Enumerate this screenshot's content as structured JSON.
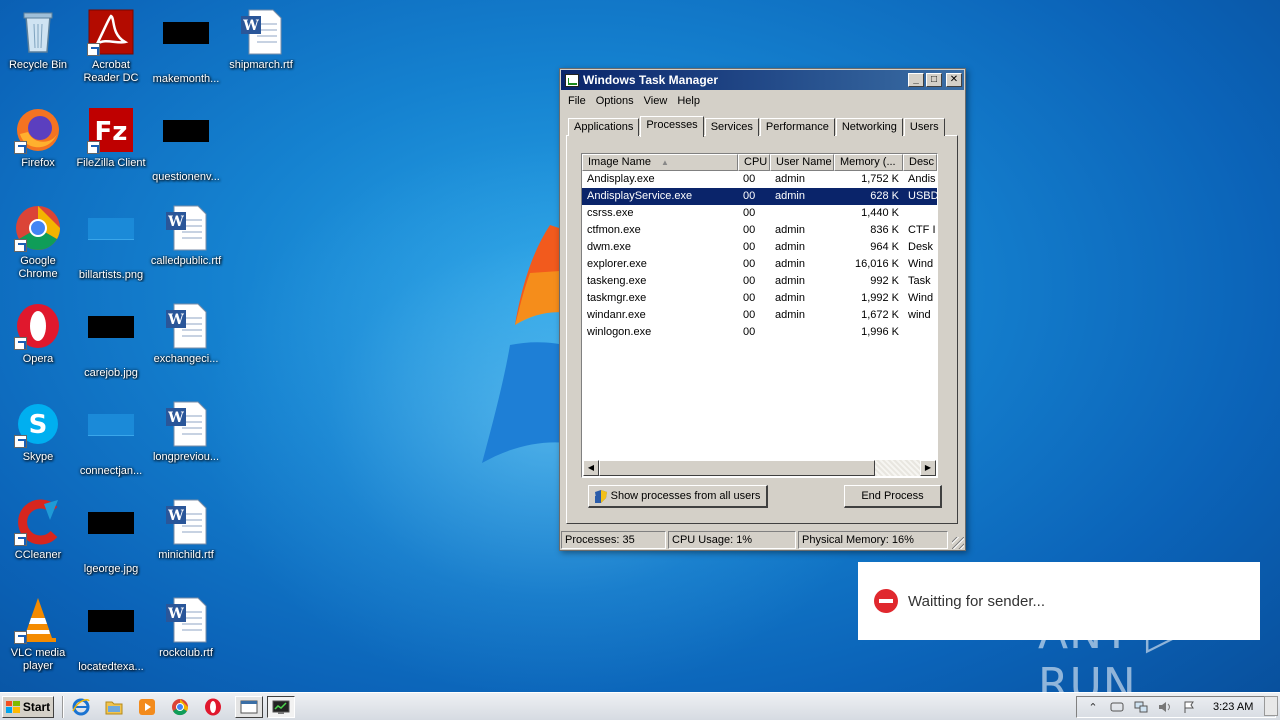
{
  "desktop": {
    "icons": [
      {
        "label": "Recycle Bin"
      },
      {
        "label": "Acrobat Reader DC"
      },
      {
        "label": "makemonth..."
      },
      {
        "label": "shipmarch.rtf"
      },
      {
        "label": "Firefox"
      },
      {
        "label": "FileZilla Client"
      },
      {
        "label": "questionenv..."
      },
      {
        "label": "Google Chrome"
      },
      {
        "label": "billartists.png"
      },
      {
        "label": "calledpublic.rtf"
      },
      {
        "label": "Opera"
      },
      {
        "label": "carejob.jpg"
      },
      {
        "label": "exchangeci..."
      },
      {
        "label": "Skype"
      },
      {
        "label": "connectjan..."
      },
      {
        "label": "longpreviou..."
      },
      {
        "label": "CCleaner"
      },
      {
        "label": "lgeorge.jpg"
      },
      {
        "label": "minichild.rtf"
      },
      {
        "label": "VLC media player"
      },
      {
        "label": "locatedtexa..."
      },
      {
        "label": "rockclub.rtf"
      }
    ]
  },
  "taskmanager": {
    "title": "Windows Task Manager",
    "menu": [
      "File",
      "Options",
      "View",
      "Help"
    ],
    "tabs": [
      "Applications",
      "Processes",
      "Services",
      "Performance",
      "Networking",
      "Users"
    ],
    "active_tab": "Processes",
    "columns": [
      "Image Name",
      "CPU",
      "User Name",
      "Memory (...",
      "Desc"
    ],
    "rows": [
      {
        "name": "Andisplay.exe",
        "cpu": "00",
        "user": "admin",
        "mem": "1,752 K",
        "desc": "Andis"
      },
      {
        "name": "AndisplayService.exe",
        "cpu": "00",
        "user": "admin",
        "mem": "628 K",
        "desc": "USBD"
      },
      {
        "name": "csrss.exe",
        "cpu": "00",
        "user": "",
        "mem": "1,440 K",
        "desc": ""
      },
      {
        "name": "ctfmon.exe",
        "cpu": "00",
        "user": "admin",
        "mem": "836 K",
        "desc": "CTF I"
      },
      {
        "name": "dwm.exe",
        "cpu": "00",
        "user": "admin",
        "mem": "964 K",
        "desc": "Desk"
      },
      {
        "name": "explorer.exe",
        "cpu": "00",
        "user": "admin",
        "mem": "16,016 K",
        "desc": "Wind"
      },
      {
        "name": "taskeng.exe",
        "cpu": "00",
        "user": "admin",
        "mem": "992 K",
        "desc": "Task"
      },
      {
        "name": "taskmgr.exe",
        "cpu": "00",
        "user": "admin",
        "mem": "1,992 K",
        "desc": "Wind"
      },
      {
        "name": "windanr.exe",
        "cpu": "00",
        "user": "admin",
        "mem": "1,672 K",
        "desc": "wind"
      },
      {
        "name": "winlogon.exe",
        "cpu": "00",
        "user": "",
        "mem": "1,996 K",
        "desc": ""
      }
    ],
    "show_all_button": "Show processes from all users",
    "end_process_button": "End Process",
    "status": {
      "processes": "Processes: 35",
      "cpu": "CPU Usage: 1%",
      "memory": "Physical Memory: 16%"
    }
  },
  "notification": {
    "message": "Waitting for sender..."
  },
  "watermark": "ANY ▷ RUN",
  "taskbar": {
    "start_label": "Start",
    "clock": "3:23 AM"
  }
}
